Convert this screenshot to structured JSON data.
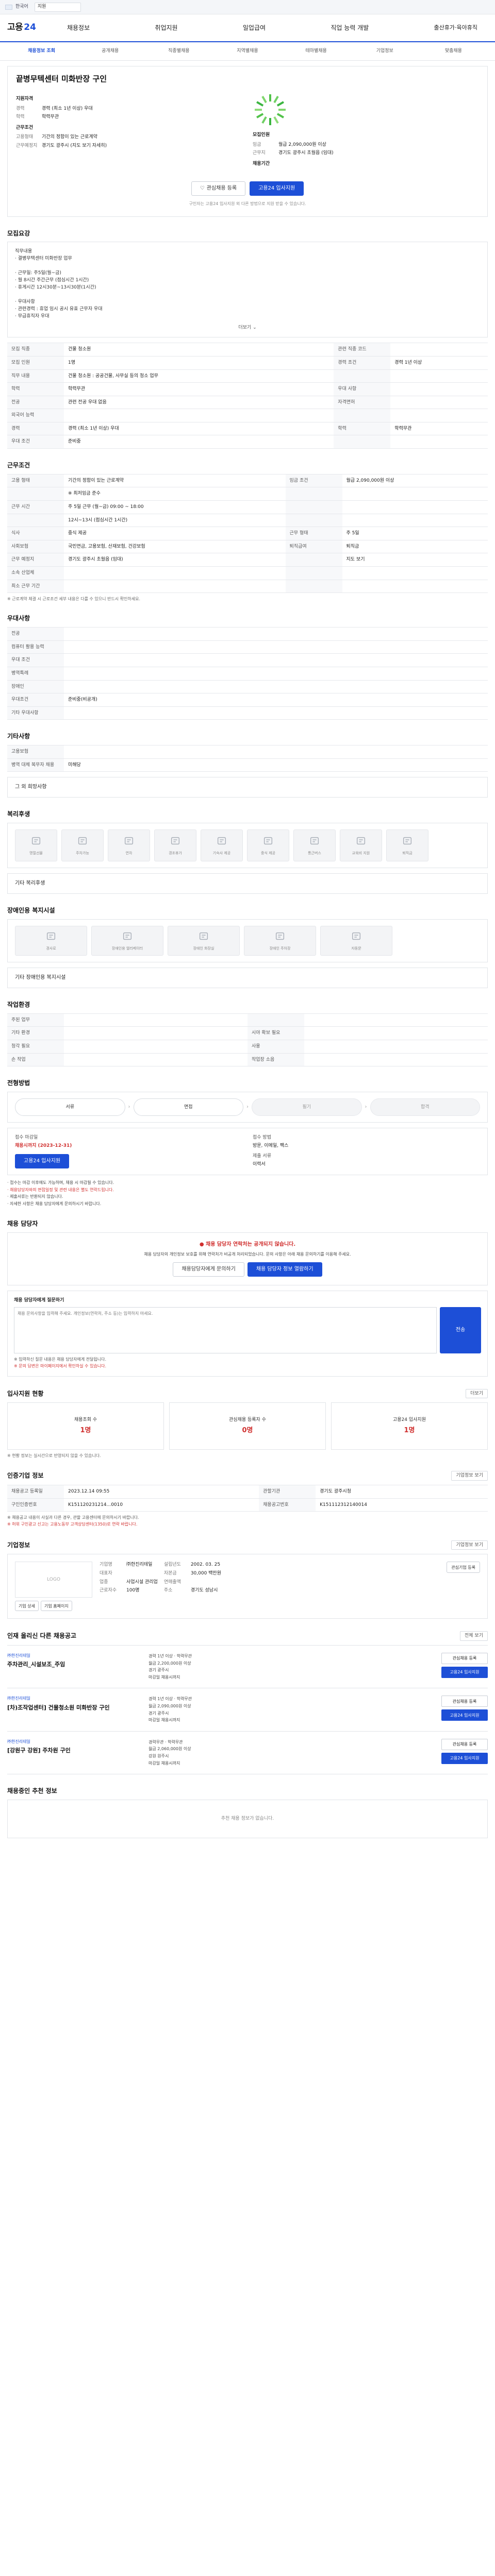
{
  "topbar": {
    "label": "한국어",
    "button_label": "지원"
  },
  "header": {
    "logo_text": "고용",
    "logo_num": "24",
    "gnb": [
      "채용정보",
      "취업지원",
      "일업급여",
      "직업 능력 개발",
      "출산휴가·육아휴직"
    ]
  },
  "subnav": [
    "채용정보 조회",
    "공개채용",
    "직종별채용",
    "지역별채용",
    "테마별채용",
    "기업정보",
    "맞춤채용"
  ],
  "hero": {
    "title": "끝병무텍센터 미화반장 구인",
    "left_block_title": "지원자격",
    "left": [
      {
        "k": "경력",
        "v": "경력 (최소 1년 이상) 우대"
      },
      {
        "k": "학력",
        "v": "학력무관"
      }
    ],
    "left_block2_title": "근무조건",
    "left2": [
      {
        "k": "고용형태",
        "v": "기간의 정함이 있는 근로계약"
      },
      {
        "k": "근무예정지",
        "v": "경기도 광주시 (지도 보기 자세히)"
      }
    ],
    "right_block_title": "모집인원",
    "right": [
      {
        "k": "임금",
        "v": "월급 2,090,000원 이상"
      },
      {
        "k": "근무지",
        "v": "경기도 광주시 초월읍 (임대)"
      }
    ],
    "right_block2_title": "채용기간",
    "like_label": "관심채용 등록",
    "apply_label": "고용24 입사지원",
    "notice": "구인자는 고용24 입사지원 외 다른 방법으로 지원 받을 수 있습니다."
  },
  "recruit": {
    "title": "모집요강",
    "body": "직무내용\n· 결병무택센터 미화반장 업무\n\n· 근무일: 주5일(월~금)\n· 월 8시간 주간근무 (점심시간 1시간)\n· 휴게시간 12시30분~13시30분(1시간)\n\n· 우대사항\n· 관련경력 : 휴업 임시 공시 유효 근무자 우대\n· 무급휴직자 우대",
    "more": "더보기 ⌄",
    "rows": [
      [
        {
          "k": "모집 직종",
          "v": "건물 청소원"
        },
        {
          "k": "관련 직종 코드",
          "v": ""
        }
      ],
      [
        {
          "k": "모집 인원",
          "v": "1명"
        },
        {
          "k": "경력 조건",
          "v": "경력 1년 이상"
        }
      ],
      [
        {
          "k": "직무 내용",
          "v": "건물 청소원 : 공공건물, 사무실 등의 청소 업무"
        },
        {
          "k": "",
          "v": ""
        }
      ],
      [
        {
          "k": "학력",
          "v": "학력무관"
        },
        {
          "k": "우대 사항",
          "v": ""
        }
      ],
      [
        {
          "k": "전공",
          "v": "관련 전공 우대 없음"
        },
        {
          "k": "자격면허",
          "v": ""
        }
      ],
      [
        {
          "k": "외국어 능력",
          "v": ""
        },
        {
          "k": "",
          "v": ""
        }
      ],
      [
        {
          "k": "경력",
          "v": "경력 (최소 1년 이상) 우대"
        },
        {
          "k": "학력",
          "v": "학력무관"
        }
      ],
      [
        {
          "k": "우대 조건",
          "v": "준비중"
        },
        {
          "k": "",
          "v": ""
        }
      ]
    ]
  },
  "conditions": {
    "title": "근무조건",
    "rows": [
      [
        {
          "k": "고용 형태",
          "v": "기간의 정함이 있는 근로계약"
        },
        {
          "k": "임금 조건",
          "v": "월급 2,090,000원 이상"
        }
      ],
      [
        {
          "k": "",
          "v": "※ 최저임금 준수"
        },
        {
          "k": "",
          "v": ""
        }
      ],
      [
        {
          "k": "근무 시간",
          "v": "주 5일 근무 (월~금) 09:00 ~ 18:00"
        },
        {
          "k": "",
          "v": ""
        }
      ],
      [
        {
          "k": "",
          "v": "12시~13시 (점심시간 1시간)"
        },
        {
          "k": "",
          "v": ""
        }
      ],
      [
        {
          "k": "식사",
          "v": "중식 제공"
        },
        {
          "k": "근무 형태",
          "v": "주 5일"
        }
      ],
      [
        {
          "k": "사회보험",
          "v": "국민연금, 고용보험, 산재보험, 건강보험"
        },
        {
          "k": "퇴직급여",
          "v": "퇴직금"
        }
      ],
      [
        {
          "k": "근무 예정지",
          "v": "경기도 광주시 초월읍 (임대)"
        },
        {
          "k": "",
          "v": "지도 보기"
        }
      ],
      [
        {
          "k": "소속 산업체",
          "v": ""
        },
        {
          "k": "",
          "v": ""
        }
      ],
      [
        {
          "k": "최소 근무 기간",
          "v": ""
        },
        {
          "k": "",
          "v": ""
        }
      ]
    ],
    "note": "※ 근로계약 체결 시 근로조건 세부 내용은 다를 수 있으니 반드시 확인하세요."
  },
  "prefer": {
    "title": "우대사항",
    "rows": [
      {
        "k": "전공",
        "v": ""
      },
      {
        "k": "컴퓨터 활용 능력",
        "v": ""
      },
      {
        "k": "우대 조건",
        "v": ""
      },
      {
        "k": "병역특례",
        "v": ""
      },
      {
        "k": "장애인",
        "v": ""
      },
      {
        "k": "우대조건",
        "v": "준비중(비공개)"
      },
      {
        "k": "기타 우대사항",
        "v": ""
      }
    ]
  },
  "etc": {
    "title": "기타사항",
    "rows": [
      {
        "k": "고용보험",
        "v": ""
      },
      {
        "k": "병역 대체 복무자 채용",
        "v": "미해당"
      }
    ],
    "sub": "그 외 희망사항"
  },
  "welfare": {
    "title": "복리후생",
    "tiles": [
      {
        "icon": "bonus-icon",
        "label": "명절선물"
      },
      {
        "icon": "car-icon",
        "label": "주차가능"
      },
      {
        "icon": "calendar-icon",
        "label": "연차"
      },
      {
        "icon": "gift-icon",
        "label": "경조휴가"
      },
      {
        "icon": "building-icon",
        "label": "기숙사 제공"
      },
      {
        "icon": "meal-icon",
        "label": "중식 제공"
      },
      {
        "icon": "bus-icon",
        "label": "통근버스"
      },
      {
        "icon": "medal-icon",
        "label": "교육비 지원"
      },
      {
        "icon": "badge-icon",
        "label": "퇴직금"
      }
    ],
    "other_label": "기타 복리후생"
  },
  "facility": {
    "title": "장애인용 복지시설",
    "tiles": [
      {
        "icon": "ramp-icon",
        "label": "경사로"
      },
      {
        "icon": "elevator-icon",
        "label": "장애인용 엘리베이터"
      },
      {
        "icon": "restroom-icon",
        "label": "장애인 화장실"
      },
      {
        "icon": "parking-icon",
        "label": "장애인 주차장"
      },
      {
        "icon": "door-icon",
        "label": "자동문"
      }
    ],
    "other_label": "기타 장애인용 복지시설"
  },
  "workenv": {
    "title": "작업환경",
    "rows": [
      [
        {
          "k": "주된 업무",
          "v": ""
        },
        {
          "k": "",
          "v": ""
        }
      ],
      [
        {
          "k": "기타 환경",
          "v": ""
        },
        {
          "k": "시야 확보 필요",
          "v": ""
        }
      ],
      [
        {
          "k": "청각 필요",
          "v": ""
        },
        {
          "k": "사용",
          "v": ""
        }
      ],
      [
        {
          "k": "손 작업",
          "v": ""
        },
        {
          "k": "작업장 소음",
          "v": ""
        }
      ]
    ]
  },
  "selection": {
    "title": "전형방법",
    "steps": [
      "서류",
      "면접",
      "필기",
      "합격"
    ],
    "dim": [
      false,
      false,
      true,
      true
    ],
    "apply_cols": [
      {
        "lbl": "접수 마감일",
        "val": "채용시까지 (2023-12-31)",
        "red": true
      },
      {
        "lbl": "접수 방법",
        "val": "방문, 이메일, 팩스",
        "red": false
      },
      {
        "lbl": "제출 서류",
        "val": "이력서",
        "red": false
      }
    ],
    "apply_button": "고용24 입사지원",
    "notes": [
      "· 접수는 마감 이후에도 가능하며, 채용 시 마감될 수 있습니다.",
      "· 채용담당자와의 면접일정 및 관련 내용은 별도 연락드립니다.",
      "· 제출서류는 반환되지 않습니다.",
      "· 자세한 사항은 채용 담당자에게 문의하시기 바랍니다."
    ]
  },
  "manager": {
    "title": "채용 담당자",
    "warn": "● 채용 담당자 연락처는 공개되지 않습니다.",
    "sub": "채용 담당자의 개인정보 보호를 위해 연락처가 비공개 처리되었습니다. 문의 사항은 아래 채용 문의하기를 이용해 주세요.",
    "btn1": "채용담당자에게 문의하기",
    "btn2": "채용 담당자 정보 열람하기",
    "inq_label": "채용 담당자에게 질문하기",
    "placeholder": "채용 문의사항을 입력해 주세요. 개인정보(연락처, 주소 등)는 입력하지 마세요.",
    "send": "전송",
    "notes": [
      "※ 입력하신 질문 내용은 채용 담당자에게 전달됩니다.",
      "※ 문의 답변은 마이페이지에서 확인하실 수 있습니다."
    ]
  },
  "status": {
    "title": "입사지원 현황",
    "aside": "더보기",
    "cards": [
      {
        "lbl": "채용조회 수",
        "val": "1명"
      },
      {
        "lbl": "관심채용 등록자 수",
        "val": "0명"
      },
      {
        "lbl": "고용24 입사지원",
        "val": "1명"
      }
    ],
    "note": "※ 현황 정보는 실시간으로 반영되지 않을 수 있습니다."
  },
  "regi": {
    "title": "인증기업 정보",
    "aside": "기업정보 보기",
    "rows": [
      [
        {
          "k": "채용공고 등록일",
          "v": "2023.12.14 09:55"
        },
        {
          "k": "관할기관",
          "v": "경기도 광주시청"
        }
      ],
      [
        {
          "k": "구인인증번호",
          "v": "K151120231214...0010"
        },
        {
          "k": "채용공고번호",
          "v": "K151112312140014"
        }
      ]
    ],
    "notes": [
      "※ 채용공고 내용이 사실과 다른 경우, 관할 고용센터에 문의하시기 바랍니다.",
      "※ 허위 구인광고 신고는 고용노동부 고객상담센터(1350)로 연락 바랍니다."
    ]
  },
  "company": {
    "title": "기업정보",
    "aside": "기업정보 보기",
    "logo_alt": "LOGO",
    "col1": [
      {
        "k": "기업명",
        "v": "㈜한진리테일"
      },
      {
        "k": "대표자",
        "v": ""
      },
      {
        "k": "업종",
        "v": "사업시설 관리업"
      },
      {
        "k": "근로자수",
        "v": "100명"
      }
    ],
    "col2": [
      {
        "k": "설립년도",
        "v": "2002. 03. 25"
      },
      {
        "k": "자본금",
        "v": "30,000 백만원"
      },
      {
        "k": "연매출액",
        "v": ""
      },
      {
        "k": "주소",
        "v": "경기도 성남시"
      }
    ],
    "buttons": [
      "기업 상세",
      "기업 홈페이지",
      "관심기업 등록"
    ]
  },
  "other_jobs": {
    "title": "인재 올리신 다른 채용공고",
    "aside": "전체 보기",
    "items": [
      {
        "co": "㈜한진리테일",
        "title": "주차관리_시설보조_주임",
        "meta": [
          "경력 1년 이상 · 학력무관",
          "월급 2,200,000원 이상",
          "경기 광주시",
          "마감일 채용시까지"
        ],
        "btns": [
          "관심채용 등록",
          "고용24 입사지원"
        ]
      },
      {
        "co": "㈜한진리테일",
        "title": "[차)조작업센터] 건물청소원 미화반장 구인",
        "meta": [
          "경력 1년 이상 · 학력무관",
          "월급 2,090,000원 이상",
          "경기 광주시",
          "마감일 채용시까지"
        ],
        "btns": [
          "관심채용 등록",
          "고용24 입사지원"
        ]
      },
      {
        "co": "㈜한진리테일",
        "title": "[강원구 강원] 주차원 구인",
        "meta": [
          "경력무관 · 학력무관",
          "월급 2,060,000원 이상",
          "강원 원주시",
          "마감일 채용시까지"
        ],
        "btns": [
          "관심채용 등록",
          "고용24 입사지원"
        ]
      }
    ]
  },
  "recommend": {
    "title": "채용중인 추천 정보",
    "empty": "추천 채용 정보가 없습니다."
  }
}
